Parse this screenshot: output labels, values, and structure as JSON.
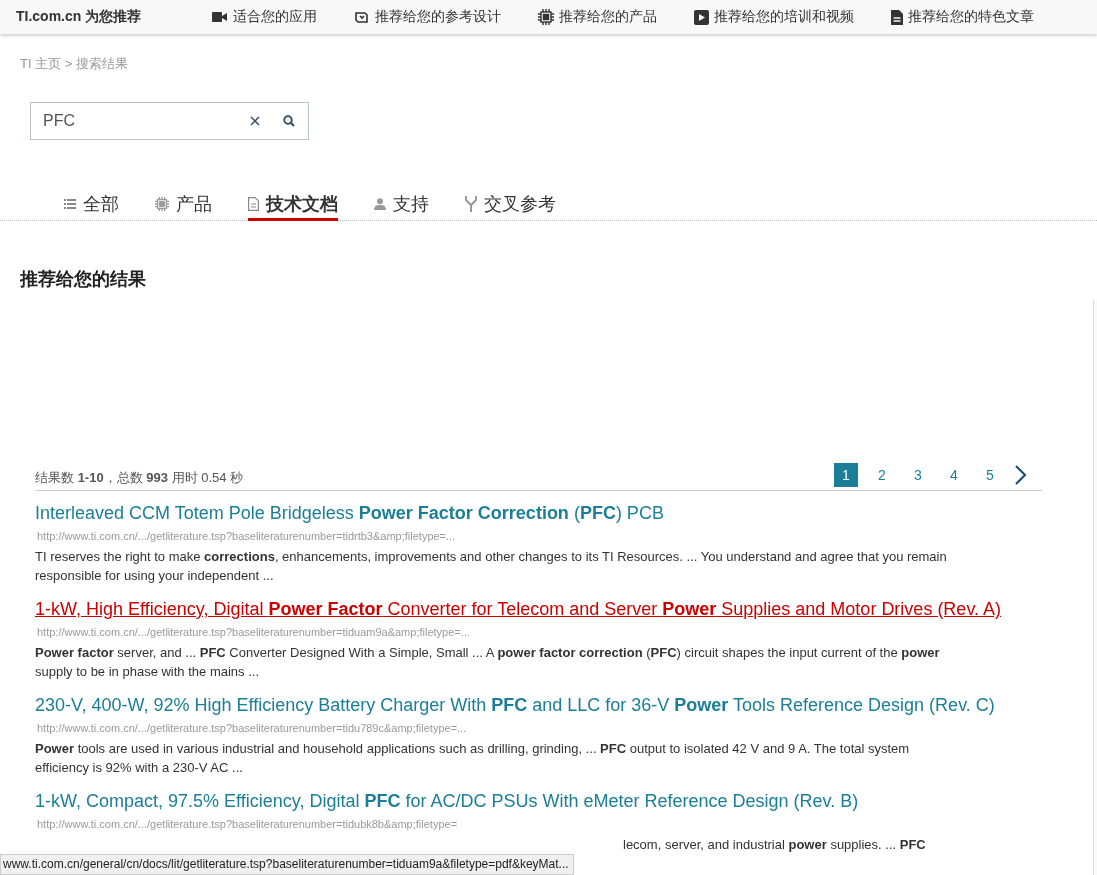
{
  "top_nav": {
    "brand": "TI.com.cn 为您推荐",
    "items": [
      {
        "label": "适合您的应用",
        "kind": "camera"
      },
      {
        "label": "推荐给您的参考设计",
        "kind": "design"
      },
      {
        "label": "推荐给您的产品",
        "kind": "chip"
      },
      {
        "label": "推荐给您的培训和视频",
        "kind": "play"
      },
      {
        "label": "推荐给您的特色文章",
        "kind": "doc"
      }
    ]
  },
  "breadcrumb": "TI 主页 > 搜索结果",
  "search": {
    "value": "PFC"
  },
  "tabs": [
    {
      "label": "全部",
      "kind": "list",
      "selected": false
    },
    {
      "label": "产品",
      "kind": "chip",
      "selected": false
    },
    {
      "label": "技术文档",
      "kind": "doc",
      "selected": true
    },
    {
      "label": "支持",
      "kind": "person",
      "selected": false
    },
    {
      "label": "交叉参考",
      "kind": "fork",
      "selected": false
    }
  ],
  "heading": "推荐给您的结果",
  "stats": "结果数 **1-10**，总数 **993** 用时 0.54 秒",
  "pagination": [
    {
      "label": "1",
      "selected": true
    },
    {
      "label": "2",
      "selected": false
    },
    {
      "label": "3",
      "selected": false
    },
    {
      "label": "4",
      "selected": false
    },
    {
      "label": "5",
      "selected": false
    }
  ],
  "results": [
    {
      "title": "Interleaved CCM Totem Pole Bridgeless **Power Factor Correction** (**PFC**) PCB",
      "hovered": false,
      "url": "http://www.ti.com.cn/.../getliterature.tsp?baseliteraturenumber=tidrtb3&amp;filetype=...",
      "snippet": "TI reserves the right to make **corrections**, enhancements, improvements and other changes to its TI Resources. ... You understand and agree that you remain responsible for using your independent ..."
    },
    {
      "title": "1-kW, High Efficiency, Digital **Power Factor** Converter for Telecom and Server **Power** Supplies and Motor Drives (Rev. A)",
      "hovered": true,
      "url": "http://www.ti.com.cn/.../getliterature.tsp?baseliteraturenumber=tiduam9a&amp;filetype=...",
      "snippet": "**Power factor** server, and ... **PFC** Converter Designed With a Simple, Small ... A **power factor correction** (**PFC**) circuit shapes the input current of the **power** supply to be in phase with the mains ..."
    },
    {
      "title": "230-V, 400-W, 92% High Efficiency Battery Charger With **PFC** and LLC for 36-V **Power** Tools Reference Design (Rev. C)",
      "hovered": false,
      "url": "http://www.ti.com.cn/.../getliterature.tsp?baseliteraturenumber=tidu789c&amp;filetype=...",
      "snippet": "**Power** tools are used in various industrial and household applications such as drilling, grinding, ... **PFC** output to isolated 42 V and 9 A. The total system efficiency is 92% with a 230-V AC ..."
    },
    {
      "title": "1-kW, Compact, 97.5% Efficiency, Digital **PFC** for AC/DC PSUs With eMeter Reference Design (Rev. B)",
      "hovered": false,
      "url": "http://www.ti.com.cn/.../getliterature.tsp?baseliteraturenumber=tidubk8b&amp;filetype=",
      "snippet": "lecom, server, and industrial **power** supplies. ... **PFC**"
    }
  ],
  "status_bar": "www.ti.com.cn/general/cn/docs/lit/getliterature.tsp?baseliteraturenumber=tiduam9a&filetype=pdf&keyMat..."
}
